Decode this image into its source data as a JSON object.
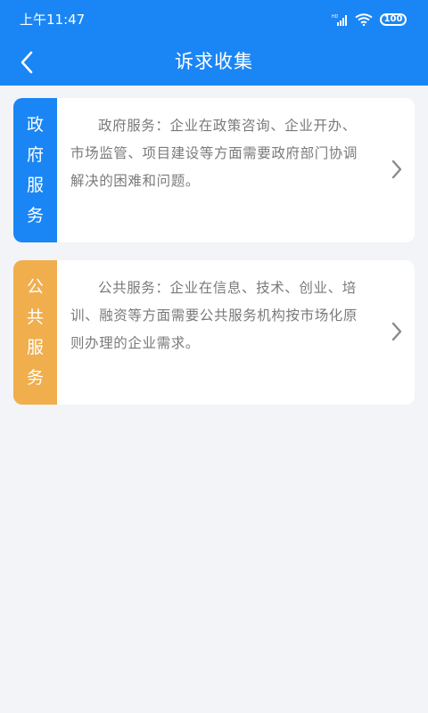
{
  "status_bar": {
    "time": "上午11:47",
    "battery": "100",
    "signal_icon": "signal-icon",
    "wifi_icon": "wifi-icon"
  },
  "header": {
    "title": "诉求收集",
    "back_icon": "back-arrow-icon"
  },
  "cards": [
    {
      "tag_chars": [
        "政",
        "府",
        "服",
        "务"
      ],
      "tag_color": "#1a86f5",
      "description": "政府服务：企业在政策咨询、企业开办、市场监管、项目建设等方面需要政府部门协调解决的困难和问题。"
    },
    {
      "tag_chars": [
        "公",
        "共",
        "服",
        "务"
      ],
      "tag_color": "#f0ae4d",
      "description": "公共服务：企业在信息、技术、创业、培训、融资等方面需要公共服务机构按市场化原则办理的企业需求。"
    }
  ],
  "colors": {
    "primary": "#1a86f5",
    "background": "#f2f4f7",
    "accent_orange": "#f0ae4d",
    "text_gray": "#7a7a7a"
  }
}
